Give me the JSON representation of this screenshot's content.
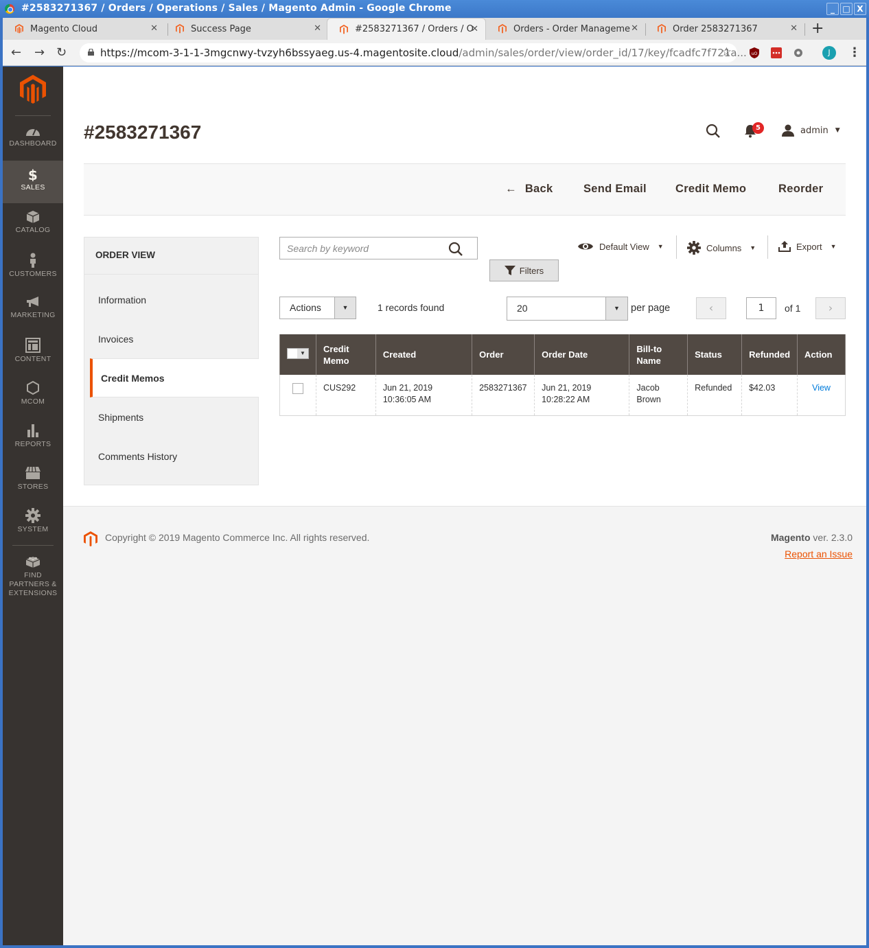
{
  "window": {
    "title": "#2583271367 / Orders / Operations / Sales / Magento Admin - Google Chrome",
    "controls": [
      "_",
      "□",
      "X"
    ]
  },
  "browser": {
    "tabs": [
      {
        "label": "Magento Cloud",
        "active": false
      },
      {
        "label": "Success Page",
        "active": false
      },
      {
        "label": "#2583271367 / Orders / O",
        "active": true
      },
      {
        "label": "Orders - Order Manageme",
        "active": false
      },
      {
        "label": "Order 2583271367",
        "active": false
      }
    ],
    "new_tab": "+",
    "url_host": "https://mcom-3-1-1-3mgcnwy-tvzyh6bssyaeg.us-4.magentosite.cloud",
    "url_path": "/admin/sales/order/view/order_id/17/key/fcadfc7f721a...",
    "avatar_initial": "J"
  },
  "admin_nav": {
    "items": [
      {
        "label": "DASHBOARD",
        "icon": "dashboard-icon",
        "active": false
      },
      {
        "label": "SALES",
        "icon": "dollar-icon",
        "active": true
      },
      {
        "label": "CATALOG",
        "icon": "box-icon",
        "active": false
      },
      {
        "label": "CUSTOMERS",
        "icon": "person-icon",
        "active": false
      },
      {
        "label": "MARKETING",
        "icon": "megaphone-icon",
        "active": false
      },
      {
        "label": "CONTENT",
        "icon": "layout-icon",
        "active": false
      },
      {
        "label": "MCOM",
        "icon": "hexagon-icon",
        "active": false
      },
      {
        "label": "REPORTS",
        "icon": "bar-chart-icon",
        "active": false
      },
      {
        "label": "STORES",
        "icon": "storefront-icon",
        "active": false
      },
      {
        "label": "SYSTEM",
        "icon": "gear-icon",
        "active": false
      }
    ],
    "extensions": {
      "line1": "FIND",
      "line2": "PARTNERS &",
      "line3": "EXTENSIONS"
    }
  },
  "header": {
    "page_title": "#2583271367",
    "notifications_count": "5",
    "user": "admin"
  },
  "action_bar": {
    "back": "Back",
    "send_email": "Send Email",
    "credit_memo": "Credit Memo",
    "reorder": "Reorder"
  },
  "order_view": {
    "title": "ORDER VIEW",
    "tabs": [
      {
        "label": "Information",
        "active": false
      },
      {
        "label": "Invoices",
        "active": false
      },
      {
        "label": "Credit Memos",
        "active": true
      },
      {
        "label": "Shipments",
        "active": false
      },
      {
        "label": "Comments History",
        "active": false
      }
    ]
  },
  "grid_toolbar": {
    "search_placeholder": "Search by keyword",
    "filters": "Filters",
    "default_view": "Default View",
    "columns": "Columns",
    "export": "Export",
    "actions": "Actions",
    "records_found": "1 records found",
    "per_page_value": "20",
    "per_page_label": "per page",
    "current_page": "1",
    "total_pages": "of 1"
  },
  "grid": {
    "columns": [
      "Credit Memo",
      "Created",
      "Order",
      "Order Date",
      "Bill-to Name",
      "Status",
      "Refunded",
      "Action"
    ],
    "rows": [
      {
        "credit_memo": "CUS292",
        "created_date": "Jun 21, 2019",
        "created_time": "10:36:05 AM",
        "order": "2583271367",
        "order_date": "Jun 21, 2019",
        "order_time": "10:28:22 AM",
        "bill_first": "Jacob",
        "bill_last": "Brown",
        "status": "Refunded",
        "refunded": "$42.03",
        "action": "View"
      }
    ]
  },
  "footer": {
    "copyright": "Copyright © 2019 Magento Commerce Inc. All rights reserved.",
    "brand": "Magento",
    "version": " ver. 2.3.0",
    "report": "Report an Issue"
  },
  "colors": {
    "accent": "#eb5202",
    "nav_bg": "#373330",
    "grid_header": "#514943",
    "link": "#007bdb",
    "badge": "#e22626"
  }
}
